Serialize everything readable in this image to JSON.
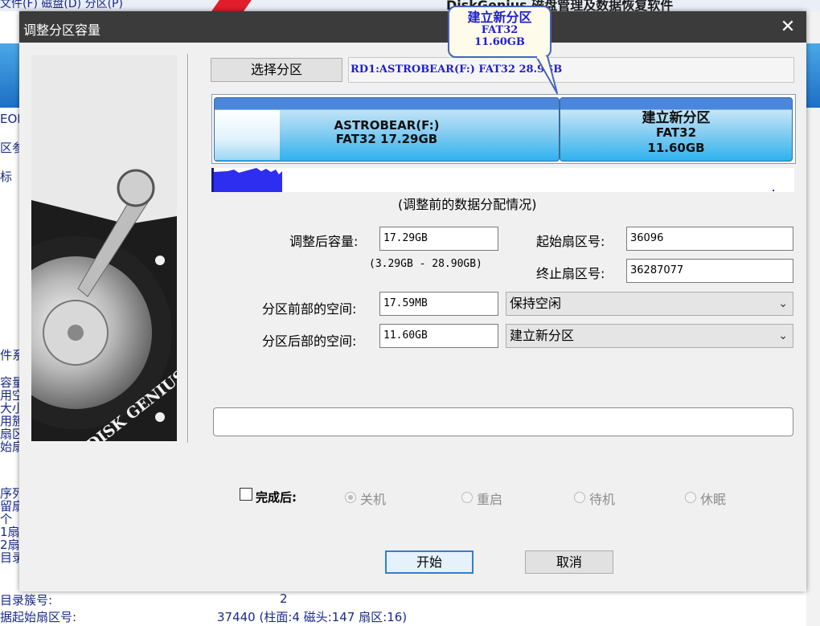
{
  "background": {
    "top_left_text": "文件(F)  磁盘(D)  分区(P)",
    "top_right_text": "DiskGenius 磁盘管理及数据恢复软件",
    "left_labels": [
      "EOI",
      "区参",
      "标",
      "件系",
      "容量",
      "用空",
      "大小",
      "用簇",
      "扇区",
      "始扇",
      "序列",
      "留扇",
      "个",
      "1扇",
      "2扇",
      "目录"
    ],
    "bottom_row1_label": "目录簇号:",
    "bottom_row1_value": "2",
    "bottom_row2_label": "据起始扇区号:",
    "bottom_row2_value": "37440 (柱面:4 磁头:147 扇区:16)"
  },
  "dialog": {
    "title": "调整分区容量",
    "close_glyph": "✕",
    "select_partition_label": "选择分区",
    "partition_path": "RD1:ASTROBEAR(F:) FAT32 28.9GB",
    "tooltip": {
      "name": "建立新分区",
      "fs": "FAT32",
      "size": "11.60GB"
    },
    "segments": [
      {
        "name": "ASTROBEAR(F:)",
        "detail": "FAT32 17.29GB"
      },
      {
        "name": "建立新分区",
        "fs": "FAT32",
        "size": "11.60GB"
      }
    ],
    "usage_caption": "(调整前的数据分配情况)",
    "new_size_label": "调整后容量:",
    "new_size_value": "17.29GB",
    "size_range": "(3.29GB - 28.90GB)",
    "start_sector_label": "起始扇区号:",
    "start_sector_value": "36096",
    "end_sector_label": "终止扇区号:",
    "end_sector_value": "36287077",
    "front_space_label": "分区前部的空间:",
    "front_space_value": "17.59MB",
    "front_space_action": "保持空闲",
    "back_space_label": "分区后部的空间:",
    "back_space_value": "11.60GB",
    "back_space_action": "建立新分区",
    "after_label": "完成后:",
    "after_options": [
      "关机",
      "重启",
      "待机",
      "休眠"
    ],
    "start_button": "开始",
    "cancel_button": "取消",
    "art_text": "DISK GENIUS",
    "colors": {
      "titlebar": "#3b3b3b",
      "path_text": "#1f1fd2",
      "segment_top": "#4a86dc",
      "segment_fill": "#2fb2ee",
      "usage_fill": "#2e2ef0"
    }
  }
}
